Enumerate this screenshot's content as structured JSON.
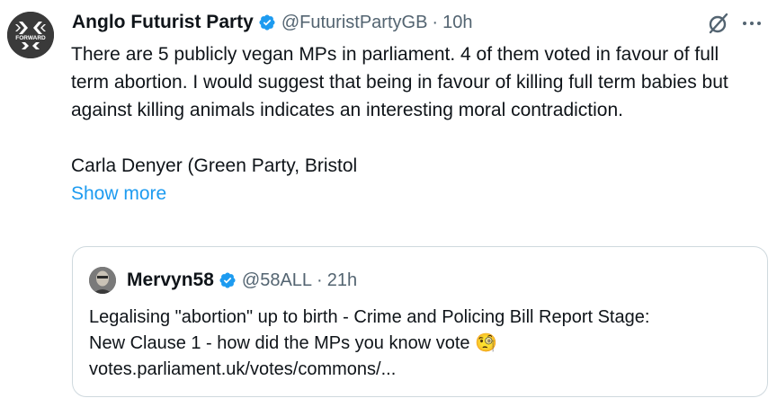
{
  "tweet": {
    "author_name": "Anglo Futurist Party",
    "handle": "@FuturistPartyGB",
    "separator": "·",
    "time": "10h",
    "avatar_text": "FORWARD",
    "body_lines": [
      "There are  5 publicly vegan MPs in parliament. 4 of them voted in favour of full term abortion. I would suggest that being in favour of killing full term babies but against killing animals indicates an interesting moral contradiction.",
      "Carla Denyer (Green Party, Bristol"
    ],
    "show_more_label": "Show more"
  },
  "quoted_tweet": {
    "author_name": "Mervyn58",
    "handle": "@58ALL",
    "separator": "·",
    "time": "21h",
    "body_lines": [
      "Legalising \"abortion\" up to birth - Crime and Policing Bill Report Stage:",
      "New Clause 1 - how did the MPs you know vote 🧐",
      "votes.parliament.uk/votes/commons/..."
    ]
  },
  "icons": {
    "verified": "verified-badge-icon",
    "grok": "grok-icon",
    "more": "more-options-icon"
  },
  "colors": {
    "text": "#0f1419",
    "secondary": "#536471",
    "link": "#1d9bf0",
    "verified": "#1d9bf0",
    "border": "#cfd9de"
  }
}
